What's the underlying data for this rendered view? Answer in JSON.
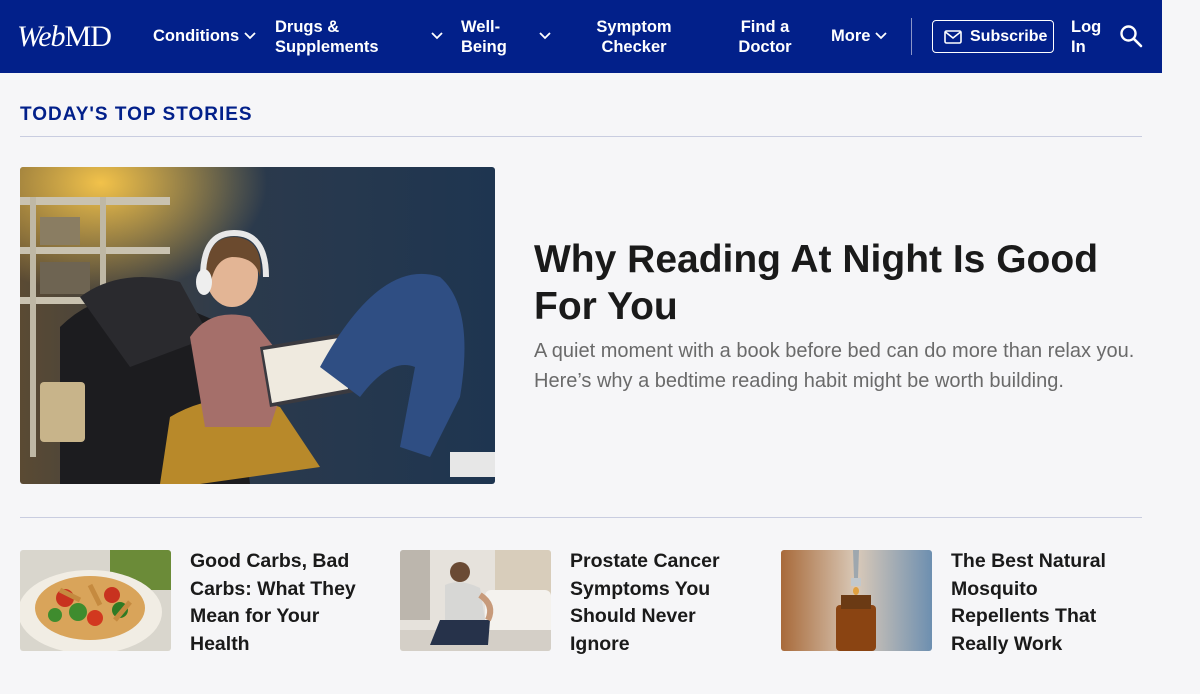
{
  "header": {
    "logo": {
      "part1": "Web",
      "part2": "MD"
    },
    "nav": [
      {
        "label": "Conditions",
        "has_dropdown": true
      },
      {
        "label": "Drugs & Supplements",
        "has_dropdown": true
      },
      {
        "label": "Well-Being",
        "has_dropdown": true
      },
      {
        "label": "Symptom Checker",
        "has_dropdown": false
      },
      {
        "label": "Find a Doctor",
        "has_dropdown": false
      },
      {
        "label": "More",
        "has_dropdown": true
      }
    ],
    "subscribe_label": "Subscribe",
    "login_label": "Log In",
    "icons": {
      "search": "search-icon",
      "subscribe": "mail-icon",
      "dropdown": "chevron-down-icon"
    }
  },
  "section": {
    "title": "TODAY'S TOP STORIES"
  },
  "hero": {
    "title": "Why Reading At Night Is Good For You",
    "subtitle": "A quiet moment with a book before bed can do more than relax you. Here’s why a bedtime reading habit might be worth building."
  },
  "cards": [
    {
      "title": "Good Carbs, Bad Carbs: What They Mean for Your Health"
    },
    {
      "title": "Prostate Cancer Symptoms You Should Never Ignore"
    },
    {
      "title": "The Best Natural Mosquito Repellents That Really Work"
    }
  ],
  "colors": {
    "brand": "#02208a",
    "background": "#f6f6f8",
    "headline": "#1a1a1a",
    "subtext": "#6a6a6a"
  }
}
